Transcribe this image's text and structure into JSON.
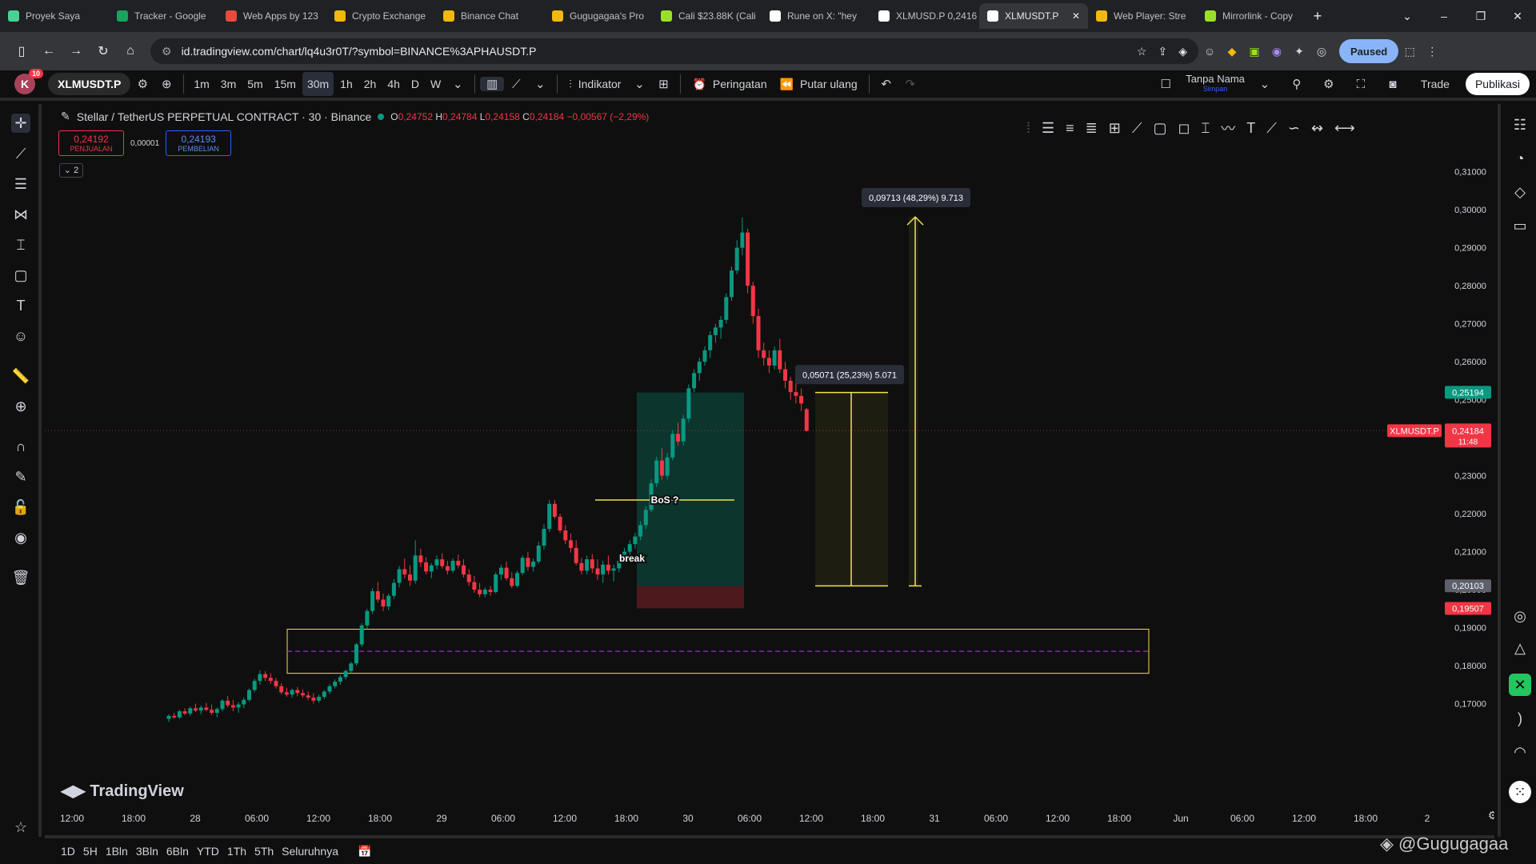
{
  "browser": {
    "tabs": [
      {
        "label": "Proyek Saya",
        "color": "#4ad295"
      },
      {
        "label": "Tracker - Google",
        "color": "#1aa260"
      },
      {
        "label": "Web Apps by 123",
        "color": "#e84b3c"
      },
      {
        "label": "Crypto Exchange",
        "color": "#f0b90b"
      },
      {
        "label": "Binance Chat",
        "color": "#f0b90b"
      },
      {
        "label": "Gugugagaa's Pro",
        "color": "#f0b90b"
      },
      {
        "label": "Cali $23.88K (Cali",
        "color": "#9be028"
      },
      {
        "label": "Rune on X: \"hey",
        "color": "#ffffff"
      },
      {
        "label": "XLMUSD.P 0,2416",
        "color": "#ffffff"
      },
      {
        "label": "XLMUSDT.P",
        "color": "#ffffff"
      },
      {
        "label": "Web Player: Stre",
        "color": "#f0b90b"
      },
      {
        "label": "Mirrorlink - Copy",
        "color": "#9be028"
      }
    ],
    "url": "id.tradingview.com/chart/lq4u3r0T/?symbol=BINANCE%3APHAUSDT.P",
    "paused_label": "Paused"
  },
  "toolbar": {
    "avatar_letter": "K",
    "notif_count": "10",
    "symbol": "XLMUSDT.P",
    "timeframes": [
      "1m",
      "3m",
      "5m",
      "15m",
      "30m",
      "1h",
      "2h",
      "4h",
      "D",
      "W"
    ],
    "active_timeframe": "30m",
    "indicator_label": "Indikator",
    "alert_label": "Peringatan",
    "replay_label": "Putar ulang",
    "layout_name": "Tanpa Nama",
    "layout_sub": "Simpan",
    "trade_label": "Trade",
    "publish_label": "Publikasi"
  },
  "legend": {
    "title": "Stellar / TetherUS PERPETUAL CONTRACT · 30 · Binance",
    "o": "0,24752",
    "h": "0,24784",
    "l": "0,24158",
    "c": "0,24184",
    "change": "−0,00567 (−2,29%)",
    "sell_price": "0,24192",
    "sell_label": "PENJUALAN",
    "spread": "0,00001",
    "buy_price": "0,24193",
    "buy_label": "PEMBELIAN",
    "collapse_count": "2"
  },
  "chart_data": {
    "type": "candlestick",
    "symbol": "XLMUSDT.P",
    "ylim": [
      0.1615,
      0.3135
    ],
    "y_ticks": [
      "0,17000",
      "0,18000",
      "0,19000",
      "0,20000",
      "0,21000",
      "0,22000",
      "0,23000",
      "0,24000",
      "0,25000",
      "0,26000",
      "0,27000",
      "0,28000",
      "0,29000",
      "0,30000",
      "0,31000"
    ],
    "x_ticks": [
      "12:00",
      "18:00",
      "28",
      "06:00",
      "12:00",
      "18:00",
      "29",
      "06:00",
      "12:00",
      "18:00",
      "30",
      "06:00",
      "12:00",
      "18:00",
      "31",
      "06:00",
      "12:00",
      "18:00",
      "Jun",
      "06:00",
      "12:00",
      "18:00",
      "2"
    ],
    "candles": [
      [
        0.166,
        0.1672,
        0.1652,
        0.1668
      ],
      [
        0.1668,
        0.1676,
        0.166,
        0.1664
      ],
      [
        0.1664,
        0.1684,
        0.166,
        0.168
      ],
      [
        0.168,
        0.1688,
        0.167,
        0.1674
      ],
      [
        0.1674,
        0.1692,
        0.1668,
        0.1688
      ],
      [
        0.1688,
        0.17,
        0.1678,
        0.1682
      ],
      [
        0.1682,
        0.1696,
        0.1672,
        0.169
      ],
      [
        0.169,
        0.1702,
        0.168,
        0.1684
      ],
      [
        0.1684,
        0.1698,
        0.167,
        0.1676
      ],
      [
        0.1676,
        0.169,
        0.1664,
        0.1686
      ],
      [
        0.1686,
        0.1712,
        0.168,
        0.1708
      ],
      [
        0.1708,
        0.172,
        0.169,
        0.1696
      ],
      [
        0.1696,
        0.171,
        0.168,
        0.169
      ],
      [
        0.169,
        0.1704,
        0.1676,
        0.1698
      ],
      [
        0.1698,
        0.1716,
        0.1688,
        0.171
      ],
      [
        0.171,
        0.174,
        0.1706,
        0.1736
      ],
      [
        0.1736,
        0.1766,
        0.173,
        0.176
      ],
      [
        0.176,
        0.1788,
        0.175,
        0.1778
      ],
      [
        0.1778,
        0.1786,
        0.176,
        0.1768
      ],
      [
        0.1768,
        0.178,
        0.1752,
        0.176
      ],
      [
        0.176,
        0.1768,
        0.174,
        0.1746
      ],
      [
        0.1746,
        0.1754,
        0.1724,
        0.173
      ],
      [
        0.173,
        0.1742,
        0.1718,
        0.1724
      ],
      [
        0.1724,
        0.174,
        0.1716,
        0.1736
      ],
      [
        0.1736,
        0.1744,
        0.172,
        0.1728
      ],
      [
        0.1728,
        0.1738,
        0.1716,
        0.1722
      ],
      [
        0.1722,
        0.1732,
        0.171,
        0.1716
      ],
      [
        0.1716,
        0.1728,
        0.17,
        0.1708
      ],
      [
        0.1708,
        0.1724,
        0.1702,
        0.1718
      ],
      [
        0.1718,
        0.1736,
        0.1712,
        0.1732
      ],
      [
        0.1732,
        0.1752,
        0.1726,
        0.1746
      ],
      [
        0.1746,
        0.1764,
        0.174,
        0.1758
      ],
      [
        0.1758,
        0.1776,
        0.175,
        0.177
      ],
      [
        0.177,
        0.179,
        0.1764,
        0.1786
      ],
      [
        0.1786,
        0.181,
        0.178,
        0.1806
      ],
      [
        0.1806,
        0.186,
        0.18,
        0.1856
      ],
      [
        0.1856,
        0.1912,
        0.185,
        0.1906
      ],
      [
        0.1906,
        0.195,
        0.1896,
        0.1944
      ],
      [
        0.1944,
        0.2004,
        0.1936,
        0.1996
      ],
      [
        0.1996,
        0.202,
        0.1966,
        0.1974
      ],
      [
        0.1974,
        0.199,
        0.1944,
        0.1956
      ],
      [
        0.1956,
        0.199,
        0.1946,
        0.1984
      ],
      [
        0.1984,
        0.2028,
        0.1976,
        0.2018
      ],
      [
        0.2018,
        0.2062,
        0.2006,
        0.2054
      ],
      [
        0.2054,
        0.2082,
        0.203,
        0.204
      ],
      [
        0.204,
        0.2064,
        0.201,
        0.2024
      ],
      [
        0.2024,
        0.213,
        0.2016,
        0.209
      ],
      [
        0.209,
        0.2108,
        0.206,
        0.2072
      ],
      [
        0.2072,
        0.2086,
        0.204,
        0.2048
      ],
      [
        0.2048,
        0.207,
        0.203,
        0.2064
      ],
      [
        0.2064,
        0.209,
        0.2054,
        0.208
      ],
      [
        0.208,
        0.2096,
        0.2056,
        0.2062
      ],
      [
        0.2062,
        0.2076,
        0.204,
        0.205
      ],
      [
        0.205,
        0.2082,
        0.2044,
        0.2076
      ],
      [
        0.2076,
        0.2092,
        0.2056,
        0.2064
      ],
      [
        0.2064,
        0.208,
        0.2032,
        0.204
      ],
      [
        0.204,
        0.2054,
        0.201,
        0.202
      ],
      [
        0.202,
        0.2036,
        0.1992,
        0.2
      ],
      [
        0.2,
        0.2018,
        0.198,
        0.1988
      ],
      [
        0.1988,
        0.2006,
        0.198,
        0.2
      ],
      [
        0.2,
        0.201,
        0.1984,
        0.1994
      ],
      [
        0.1994,
        0.2046,
        0.199,
        0.204
      ],
      [
        0.204,
        0.2066,
        0.2026,
        0.2058
      ],
      [
        0.2058,
        0.2074,
        0.2024,
        0.203
      ],
      [
        0.203,
        0.2046,
        0.2004,
        0.201
      ],
      [
        0.201,
        0.205,
        0.2006,
        0.2044
      ],
      [
        0.2044,
        0.209,
        0.2038,
        0.2084
      ],
      [
        0.2084,
        0.21,
        0.205,
        0.206
      ],
      [
        0.206,
        0.2082,
        0.2048,
        0.2074
      ],
      [
        0.2074,
        0.2126,
        0.2068,
        0.2116
      ],
      [
        0.2116,
        0.2172,
        0.2106,
        0.216
      ],
      [
        0.216,
        0.2236,
        0.2152,
        0.2226
      ],
      [
        0.2226,
        0.2236,
        0.2186,
        0.2192
      ],
      [
        0.2192,
        0.22,
        0.215,
        0.2156
      ],
      [
        0.2156,
        0.217,
        0.212,
        0.213
      ],
      [
        0.213,
        0.2148,
        0.2098,
        0.211
      ],
      [
        0.211,
        0.213,
        0.2064,
        0.207
      ],
      [
        0.207,
        0.2084,
        0.204,
        0.205
      ],
      [
        0.205,
        0.209,
        0.204,
        0.208
      ],
      [
        0.208,
        0.2094,
        0.2044,
        0.2056
      ],
      [
        0.2056,
        0.208,
        0.2026,
        0.204
      ],
      [
        0.204,
        0.2076,
        0.2018,
        0.2066
      ],
      [
        0.2066,
        0.209,
        0.204,
        0.205
      ],
      [
        0.205,
        0.2066,
        0.2022,
        0.2056
      ],
      [
        0.2056,
        0.2086,
        0.2046,
        0.2076
      ],
      [
        0.2076,
        0.211,
        0.207,
        0.21
      ],
      [
        0.21,
        0.213,
        0.2088,
        0.212
      ],
      [
        0.212,
        0.215,
        0.2108,
        0.214
      ],
      [
        0.214,
        0.218,
        0.213,
        0.217
      ],
      [
        0.217,
        0.222,
        0.216,
        0.221
      ],
      [
        0.221,
        0.229,
        0.2204,
        0.228
      ],
      [
        0.228,
        0.235,
        0.227,
        0.234
      ],
      [
        0.234,
        0.2372,
        0.229,
        0.23
      ],
      [
        0.23,
        0.236,
        0.229,
        0.2348
      ],
      [
        0.2348,
        0.242,
        0.234,
        0.241
      ],
      [
        0.241,
        0.244,
        0.238,
        0.239
      ],
      [
        0.239,
        0.246,
        0.238,
        0.245
      ],
      [
        0.245,
        0.254,
        0.244,
        0.253
      ],
      [
        0.253,
        0.258,
        0.252,
        0.257
      ],
      [
        0.257,
        0.261,
        0.255,
        0.26
      ],
      [
        0.26,
        0.264,
        0.259,
        0.263
      ],
      [
        0.263,
        0.268,
        0.261,
        0.267
      ],
      [
        0.267,
        0.27,
        0.265,
        0.269
      ],
      [
        0.269,
        0.272,
        0.266,
        0.271
      ],
      [
        0.271,
        0.278,
        0.27,
        0.277
      ],
      [
        0.277,
        0.285,
        0.276,
        0.284
      ],
      [
        0.284,
        0.292,
        0.283,
        0.29
      ],
      [
        0.29,
        0.298,
        0.288,
        0.294
      ],
      [
        0.294,
        0.295,
        0.278,
        0.28
      ],
      [
        0.28,
        0.281,
        0.27,
        0.272
      ],
      [
        0.272,
        0.274,
        0.261,
        0.263
      ],
      [
        0.263,
        0.265,
        0.259,
        0.261
      ],
      [
        0.261,
        0.263,
        0.257,
        0.259
      ],
      [
        0.259,
        0.264,
        0.258,
        0.263
      ],
      [
        0.263,
        0.266,
        0.257,
        0.258
      ],
      [
        0.258,
        0.26,
        0.253,
        0.255
      ],
      [
        0.255,
        0.256,
        0.25,
        0.252
      ],
      [
        0.252,
        0.255,
        0.249,
        0.251
      ],
      [
        0.251,
        0.253,
        0.247,
        0.249
      ],
      [
        0.2475,
        0.2478,
        0.2416,
        0.2418
      ]
    ],
    "price_labels": {
      "current_symbol": "XLMUSDT.P",
      "current": "0,24184",
      "countdown": "11:48",
      "green": "0,25194",
      "gray": "0,20103",
      "red": "0,19507"
    },
    "annotations": {
      "bos": "BoS ?",
      "break": "break",
      "measure_big": "0,09713 (48,29%) 9.713",
      "measure_small": "0,05071 (25,23%) 5.071"
    },
    "colors": {
      "up": "#089981",
      "down": "#f23645",
      "accent": "#f0e442",
      "zone": "#8e24aa"
    }
  },
  "bottom": {
    "ranges": [
      "1D",
      "5H",
      "1Bln",
      "3Bln",
      "6Bln",
      "YTD",
      "1Th",
      "5Th",
      "Seluruhnya"
    ],
    "logo": "TradingView",
    "watermark": "@Gugugagaa"
  }
}
